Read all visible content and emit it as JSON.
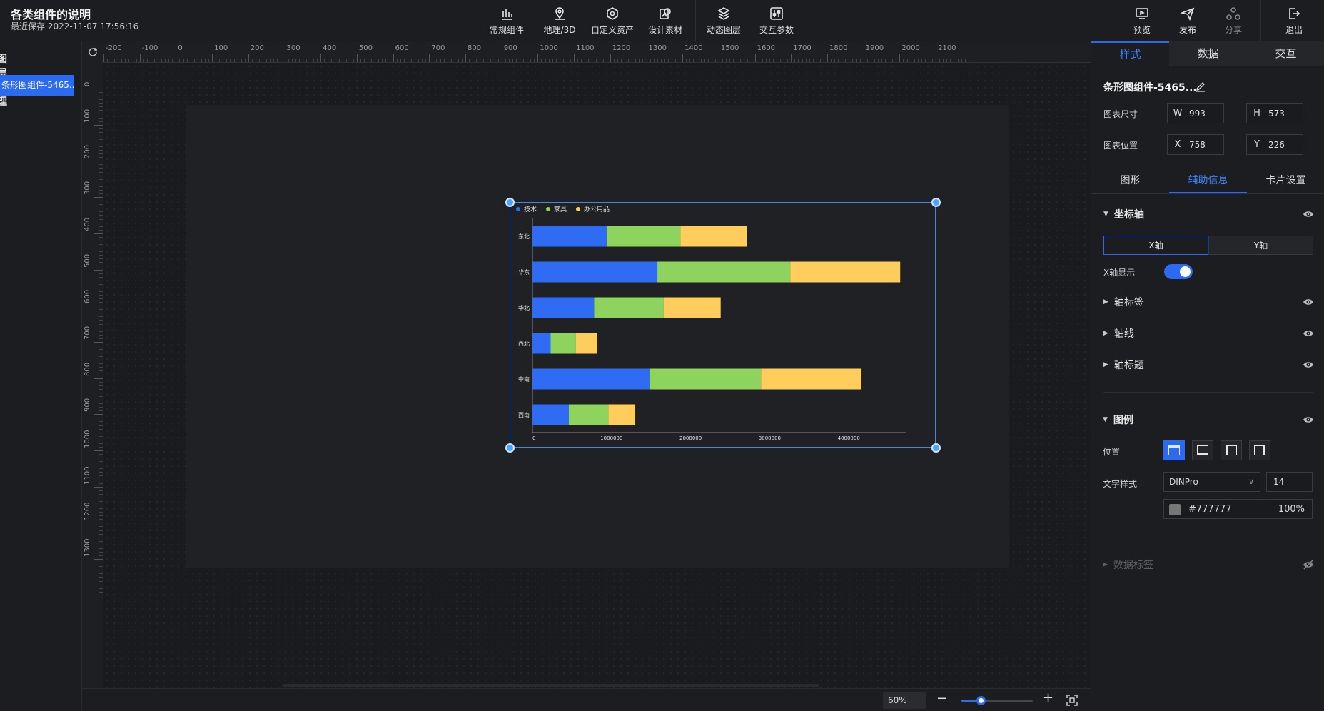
{
  "header": {
    "title": "各类组件的说明",
    "saved": "最近保存 2022-11-07 17:56:16",
    "tools": [
      {
        "label": "常规组件",
        "icon": "bar-chart-icon"
      },
      {
        "label": "地理/3D",
        "icon": "map-pin-icon"
      },
      {
        "label": "自定义资产",
        "icon": "hexagon-icon"
      },
      {
        "label": "设计素材",
        "icon": "asset-icon"
      },
      {
        "label": "动态图层",
        "icon": "layers-icon"
      },
      {
        "label": "交互参数",
        "icon": "sliders-icon"
      }
    ],
    "actions": [
      {
        "label": "预览",
        "icon": "monitor-icon"
      },
      {
        "label": "发布",
        "icon": "send-icon"
      },
      {
        "label": "分享",
        "icon": "share-icon"
      },
      {
        "label": "退出",
        "icon": "exit-icon"
      }
    ]
  },
  "layers": {
    "head": "图层管理",
    "items": [
      "条形图组件-5465..."
    ]
  },
  "rulers": {
    "h": [
      "-200",
      "-100",
      "0",
      "100",
      "200",
      "300",
      "400",
      "500",
      "600",
      "700",
      "800",
      "900",
      "1000",
      "1100",
      "1200",
      "1300",
      "1400",
      "1500",
      "1600",
      "1700",
      "1800",
      "1900",
      "2000",
      "2100"
    ],
    "v": [
      "0",
      "100",
      "200",
      "300",
      "400",
      "500",
      "600",
      "700",
      "800",
      "900",
      "1000",
      "1100",
      "1200",
      "1300"
    ]
  },
  "zoom": {
    "label": "60%",
    "level": 0.27
  },
  "chart_data": {
    "type": "bar",
    "orientation": "horizontal",
    "stacked": true,
    "categories": [
      "东北",
      "华东",
      "华北",
      "西北",
      "中南",
      "西南"
    ],
    "series": [
      {
        "name": "技术",
        "color": "#2f6cf3",
        "values": [
          940000,
          1580000,
          780000,
          230000,
          1480000,
          460000
        ]
      },
      {
        "name": "家具",
        "color": "#8ed35d",
        "values": [
          930000,
          1680000,
          880000,
          320000,
          1410000,
          500000
        ]
      },
      {
        "name": "办公用品",
        "color": "#ffcd5c",
        "values": [
          840000,
          1390000,
          720000,
          270000,
          1270000,
          340000
        ]
      }
    ],
    "xticks": [
      "0",
      "1000000",
      "2000000",
      "3000000",
      "4000000"
    ],
    "xlim": [
      0,
      5000000
    ],
    "legend": "top-left"
  },
  "panel": {
    "tabs": [
      "样式",
      "数据",
      "交互"
    ],
    "component_name": "条形图组件-5465...",
    "size_label": "图表尺寸",
    "pos_label": "图表位置",
    "w": {
      "prefix": "W",
      "value": "993"
    },
    "h": {
      "prefix": "H",
      "value": "573"
    },
    "x": {
      "prefix": "X",
      "value": "758"
    },
    "y": {
      "prefix": "Y",
      "value": "226"
    },
    "subtabs": [
      "图形",
      "辅助信息",
      "卡片设置"
    ],
    "axis_section": "坐标轴",
    "axis_tabs": [
      "X轴",
      "Y轴"
    ],
    "x_show_label": "X轴显示",
    "axis_label_section": "轴标签",
    "axis_line_section": "轴线",
    "axis_title_section": "轴标题",
    "legend_section": "图例",
    "position_label": "位置",
    "text_style_label": "文字样式",
    "font": "DINPro",
    "font_size": "14",
    "color_hex": "#777777",
    "color_opacity": "100%",
    "data_label_section": "数据标签"
  }
}
